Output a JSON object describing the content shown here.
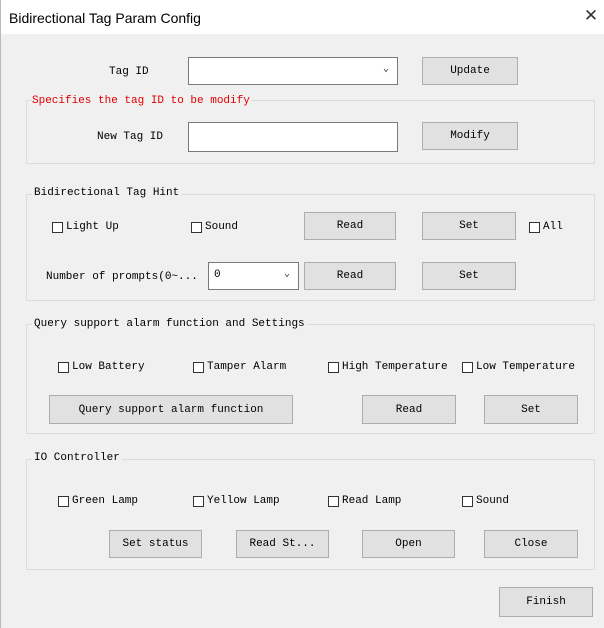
{
  "window": {
    "title": "Bidirectional Tag Param Config",
    "close_symbol": "✕"
  },
  "tag_section": {
    "tag_id_label": "Tag ID",
    "tag_id_value": "",
    "update_label": "Update",
    "hint_text": "Specifies the tag ID to be modify",
    "new_tag_id_label": "New Tag ID",
    "new_tag_id_value": "",
    "modify_label": "Modify"
  },
  "hint_group": {
    "title": "Bidirectional Tag Hint",
    "light_up_label": "Light Up",
    "sound_label": "Sound",
    "read_label": "Read",
    "set_label": "Set",
    "all_label": "All",
    "prompts_label": "Number of prompts(0~...",
    "prompts_value": "0",
    "read2_label": "Read",
    "set2_label": "Set"
  },
  "alarm_group": {
    "title": "Query support alarm function and Settings",
    "low_battery_label": "Low Battery",
    "tamper_label": "Tamper Alarm",
    "high_temp_label": "High Temperature",
    "low_temp_label": "Low Temperature",
    "query_label": "Query support alarm function",
    "read_label": "Read",
    "set_label": "Set"
  },
  "io_group": {
    "title": "IO Controller",
    "green_lamp_label": "Green Lamp",
    "yellow_lamp_label": "Yellow Lamp",
    "read_lamp_label": "Read Lamp",
    "sound_label": "Sound",
    "set_status_label": "Set status",
    "read_status_label": "Read St...",
    "open_label": "Open",
    "close_label": "Close"
  },
  "footer": {
    "finish_label": "Finish"
  }
}
